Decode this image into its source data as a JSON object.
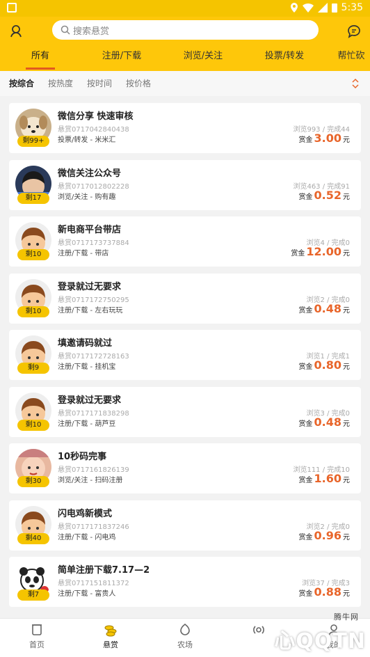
{
  "status": {
    "time": "5:35"
  },
  "header": {
    "search_placeholder": "搜索悬赏",
    "tabs": [
      "所有",
      "注册/下载",
      "浏览/关注",
      "投票/转发",
      "帮忙砍"
    ]
  },
  "sort": {
    "options": [
      "按综合",
      "按热度",
      "按时间",
      "按价格"
    ]
  },
  "listing": [
    {
      "title": "微信分享 快速审核",
      "id": "悬赏0717042840438",
      "category": "投票/转发 - 米米汇",
      "views": "浏览993 / 完成44",
      "reward_label": "赏金",
      "amount": "3.00",
      "unit": "元",
      "remaining": "剩99+",
      "avatar": "dog-photo"
    },
    {
      "title": "微信关注公众号",
      "id": "悬赏0717012802228",
      "category": "浏览/关注 - 购有趣",
      "views": "浏览463 / 完成91",
      "reward_label": "赏金",
      "amount": "0.52",
      "unit": "元",
      "remaining": "剩17",
      "avatar": "person-photo"
    },
    {
      "title": "新电商平台带店",
      "id": "悬赏0717173737884",
      "category": "注册/下载 - 带店",
      "views": "浏览4 / 完成0",
      "reward_label": "赏金",
      "amount": "12.00",
      "unit": "元",
      "remaining": "剩10",
      "avatar": "default"
    },
    {
      "title": "登录就过无要求",
      "id": "悬赏0717172750295",
      "category": "注册/下载 - 左右玩玩",
      "views": "浏览2 / 完成0",
      "reward_label": "赏金",
      "amount": "0.48",
      "unit": "元",
      "remaining": "剩10",
      "avatar": "default"
    },
    {
      "title": "填邀请码就过",
      "id": "悬赏0717172728163",
      "category": "注册/下载 - 挂机宝",
      "views": "浏览1 / 完成1",
      "reward_label": "赏金",
      "amount": "0.80",
      "unit": "元",
      "remaining": "剩9",
      "avatar": "default"
    },
    {
      "title": "登录就过无要求",
      "id": "悬赏0717171838298",
      "category": "注册/下载 - 葫芦豆",
      "views": "浏览3 / 完成0",
      "reward_label": "赏金",
      "amount": "0.48",
      "unit": "元",
      "remaining": "剩10",
      "avatar": "default"
    },
    {
      "title": "10秒码完事",
      "id": "悬赏0717161826139",
      "category": "浏览/关注 - 扫码注册",
      "views": "浏览111 / 完成10",
      "reward_label": "赏金",
      "amount": "1.60",
      "unit": "元",
      "remaining": "剩30",
      "avatar": "baby-photo"
    },
    {
      "title": "闪电鸡新模式",
      "id": "悬赏0717171837246",
      "category": "注册/下载 - 闪电鸡",
      "views": "浏览2 / 完成0",
      "reward_label": "赏金",
      "amount": "0.96",
      "unit": "元",
      "remaining": "剩40",
      "avatar": "default"
    },
    {
      "title": "简单注册下载7.17—2",
      "id": "悬赏0717151811372",
      "category": "注册/下载 - 富贵人",
      "views": "浏览37 / 完成3",
      "reward_label": "赏金",
      "amount": "0.88",
      "unit": "元",
      "remaining": "剩7",
      "avatar": "panda"
    }
  ],
  "bottom_nav": [
    "首页",
    "悬赏",
    "农场",
    "",
    "我的"
  ],
  "watermark": {
    "logo": "QQTN",
    "small": "腾牛网",
    "letter": "心"
  },
  "colors": {
    "brand": "#fec70a",
    "accent": "#e8652a",
    "badge": "#f5c400"
  }
}
